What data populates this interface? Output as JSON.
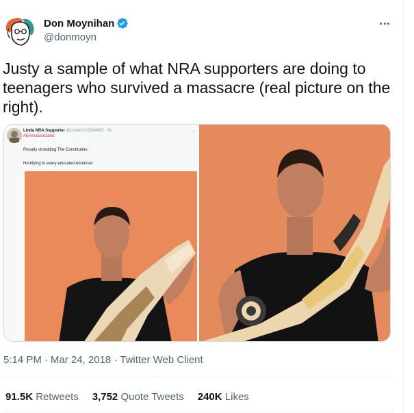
{
  "author": {
    "display_name": "Don Moynihan",
    "handle": "@donmoyn",
    "avatar_icon": "cartoon-face-avatar",
    "verified_icon": "verified-badge-icon",
    "verified_color": "#1d9bf0"
  },
  "tweet": {
    "text": "Justy a sample of what NRA supporters are doing to teenagers who survived a massacre (real picture on the right)."
  },
  "media": {
    "left": {
      "name": "Linda NRA Supporter",
      "handle": "@LindaCo03364065 · 5h",
      "hashtag": "#EmmaGonzalez",
      "line1": "Proudly shredding The Constitution.",
      "line2": "Horrifying to every educated American"
    }
  },
  "meta": {
    "time": "5:14 PM",
    "date": "Mar 24, 2018",
    "client": "Twitter Web Client",
    "separator": "·"
  },
  "stats": {
    "retweets_count": "91.5K",
    "retweets_label": "Retweets",
    "quotes_count": "3,752",
    "quotes_label": "Quote Tweets",
    "likes_count": "240K",
    "likes_label": "Likes"
  }
}
